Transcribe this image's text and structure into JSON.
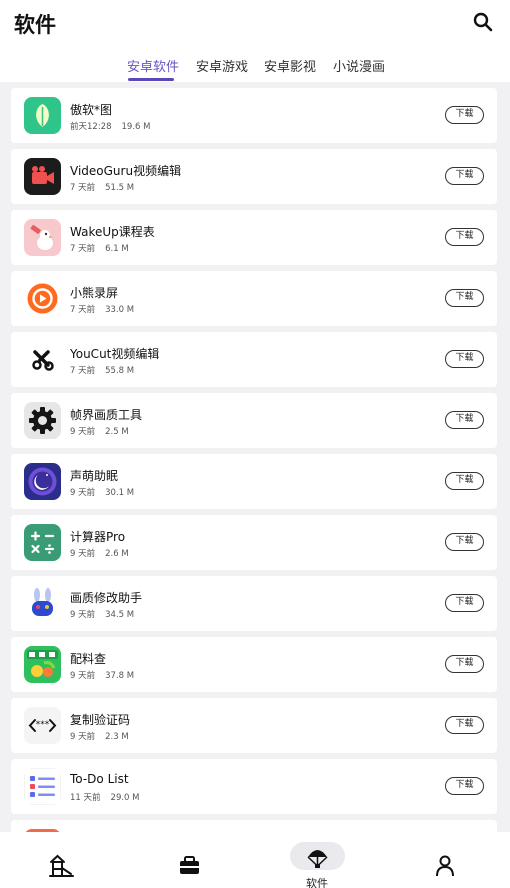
{
  "header": {
    "title": "软件"
  },
  "tabs": [
    {
      "label": "安卓软件",
      "active": true
    },
    {
      "label": "安卓游戏",
      "active": false
    },
    {
      "label": "安卓影视",
      "active": false
    },
    {
      "label": "小说漫画",
      "active": false
    }
  ],
  "download_label": "下载",
  "apps": [
    {
      "name": "傲软*图",
      "time": "前天12:28",
      "size": "19.6 M",
      "icon": "leaf-icon"
    },
    {
      "name": "VideoGuru视频编辑",
      "time": "7 天前",
      "size": "51.5 M",
      "icon": "video-camera-icon"
    },
    {
      "name": "WakeUp课程表",
      "time": "7 天前",
      "size": "6.1 M",
      "icon": "bird-icon"
    },
    {
      "name": "小熊录屏",
      "time": "7 天前",
      "size": "33.0 M",
      "icon": "record-icon"
    },
    {
      "name": "YouCut视频编辑",
      "time": "7 天前",
      "size": "55.8 M",
      "icon": "scissors-icon"
    },
    {
      "name": "帧界画质工具",
      "time": "9 天前",
      "size": "2.5 M",
      "icon": "gear-icon"
    },
    {
      "name": "声萌助眠",
      "time": "9 天前",
      "size": "30.1 M",
      "icon": "moon-icon"
    },
    {
      "name": "计算器Pro",
      "time": "9 天前",
      "size": "2.6 M",
      "icon": "calculator-icon"
    },
    {
      "name": "画质修改助手",
      "time": "9 天前",
      "size": "34.5 M",
      "icon": "bunny-icon"
    },
    {
      "name": "配料查",
      "time": "9 天前",
      "size": "37.8 M",
      "icon": "ingredient-icon"
    },
    {
      "name": "复制验证码",
      "time": "9 天前",
      "size": "2.3 M",
      "icon": "code-icon"
    },
    {
      "name": "To-Do List",
      "time": "11 天前",
      "size": "29.0 M",
      "icon": "checklist-icon"
    }
  ],
  "bottom_nav": [
    {
      "label": "",
      "icon": "playground-icon",
      "active": false
    },
    {
      "label": "",
      "icon": "toolbox-icon",
      "active": false
    },
    {
      "label": "软件",
      "icon": "parachute-icon",
      "active": true
    },
    {
      "label": "",
      "icon": "user-icon",
      "active": false
    }
  ],
  "colors": {
    "accent": "#5a48b8",
    "background": "#f1f1f4"
  }
}
